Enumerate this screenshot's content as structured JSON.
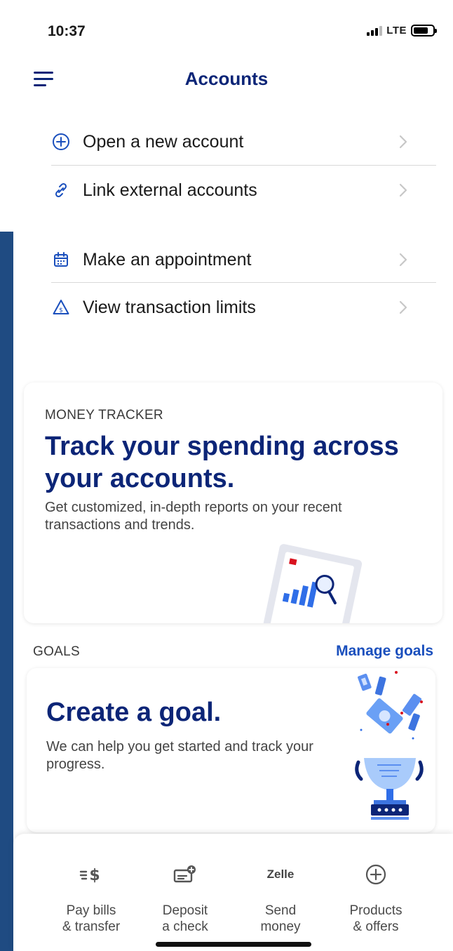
{
  "status_bar": {
    "time": "10:37",
    "network": "LTE"
  },
  "header": {
    "title": "Accounts",
    "menu_icon": "hamburger-menu-icon"
  },
  "account_actions": [
    {
      "label": "Open a new account",
      "icon": "plus-circle-icon"
    },
    {
      "label": "Link external accounts",
      "icon": "link-icon"
    },
    {
      "label": "Make an appointment",
      "icon": "calendar-icon"
    },
    {
      "label": "View transaction limits",
      "icon": "warning-dollar-icon"
    }
  ],
  "money_tracker": {
    "eyebrow": "MONEY TRACKER",
    "headline": "Track your spending across your accounts.",
    "body": "Get customized, in-depth reports on your recent transactions and trends."
  },
  "goals": {
    "section_label": "GOALS",
    "manage_link": "Manage goals",
    "headline": "Create a goal.",
    "body": "We can help you get started and track your progress."
  },
  "bottom_actions": [
    {
      "label": "Pay bills\n& transfer",
      "icon": "pay-bills-icon"
    },
    {
      "label": "Deposit\na check",
      "icon": "deposit-check-icon"
    },
    {
      "label": "Send\nmoney",
      "icon": "zelle-icon",
      "icon_text": "Zelle"
    },
    {
      "label": "Products\n& offers",
      "icon": "plus-circle-icon"
    }
  ],
  "colors": {
    "brand_navy": "#0c2577",
    "link_blue": "#1a4fbd",
    "side_strip": "#1f4b82"
  }
}
